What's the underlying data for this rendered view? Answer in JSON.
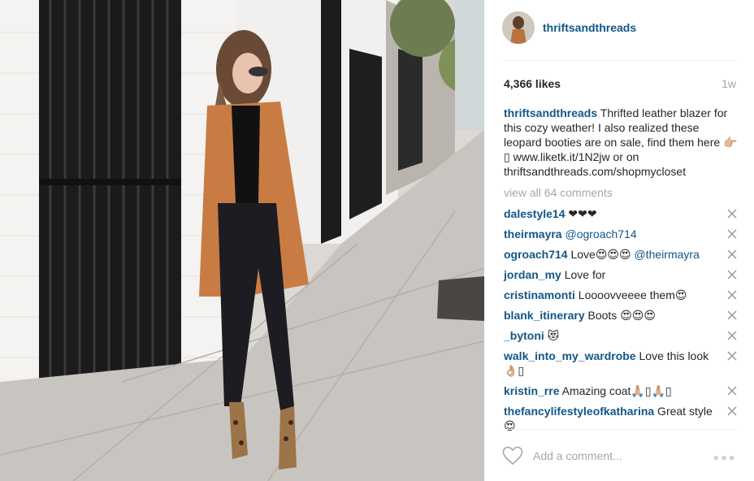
{
  "post": {
    "username": "thriftsandthreads",
    "likes": "4,366 likes",
    "time": "1w",
    "caption": {
      "user": "thriftsandthreads",
      "text": "Thrifted leather blazer for this cozy weather! I also realized these leopard booties are on sale, find them here 👉🏼‌▯ www.liketk.it/1N2jw or on thriftsandthreads.com/shopmycloset"
    },
    "view_all": "view all 64 comments",
    "add_comment_placeholder": "Add a comment...",
    "more_label": "∘∘∘"
  },
  "comments": [
    {
      "user": "dalestyle14",
      "text": " ❤❤❤",
      "mention": ""
    },
    {
      "user": "theirmayra",
      "text": " ",
      "mention": "@ogroach714"
    },
    {
      "user": "ogroach714",
      "text": " Love😍😍😍 ",
      "mention": "@theirmayra"
    },
    {
      "user": "jordan_my",
      "text": " Love for",
      "mention": ""
    },
    {
      "user": "cristinamonti",
      "text": " Loooovveeee them😍",
      "mention": ""
    },
    {
      "user": "blank_itinerary",
      "text": " Boots 😍😍😍",
      "mention": ""
    },
    {
      "user": "_bytoni",
      "text": " 😻",
      "mention": ""
    },
    {
      "user": "walk_into_my_wardrobe",
      "text": " Love this look 👌🏼▯",
      "mention": ""
    },
    {
      "user": "kristin_rre",
      "text": " Amazing coat🙏🏼▯🙏🏼▯",
      "mention": ""
    },
    {
      "user": "thefancylifestyleofkatharina",
      "text": " Great style 😍",
      "mention": ""
    }
  ],
  "icons": {
    "close": "close-icon",
    "heart": "heart-icon",
    "more": "more-options-icon"
  },
  "colors": {
    "username": "#125688",
    "muted": "#a5a7aa",
    "text": "#262626"
  }
}
